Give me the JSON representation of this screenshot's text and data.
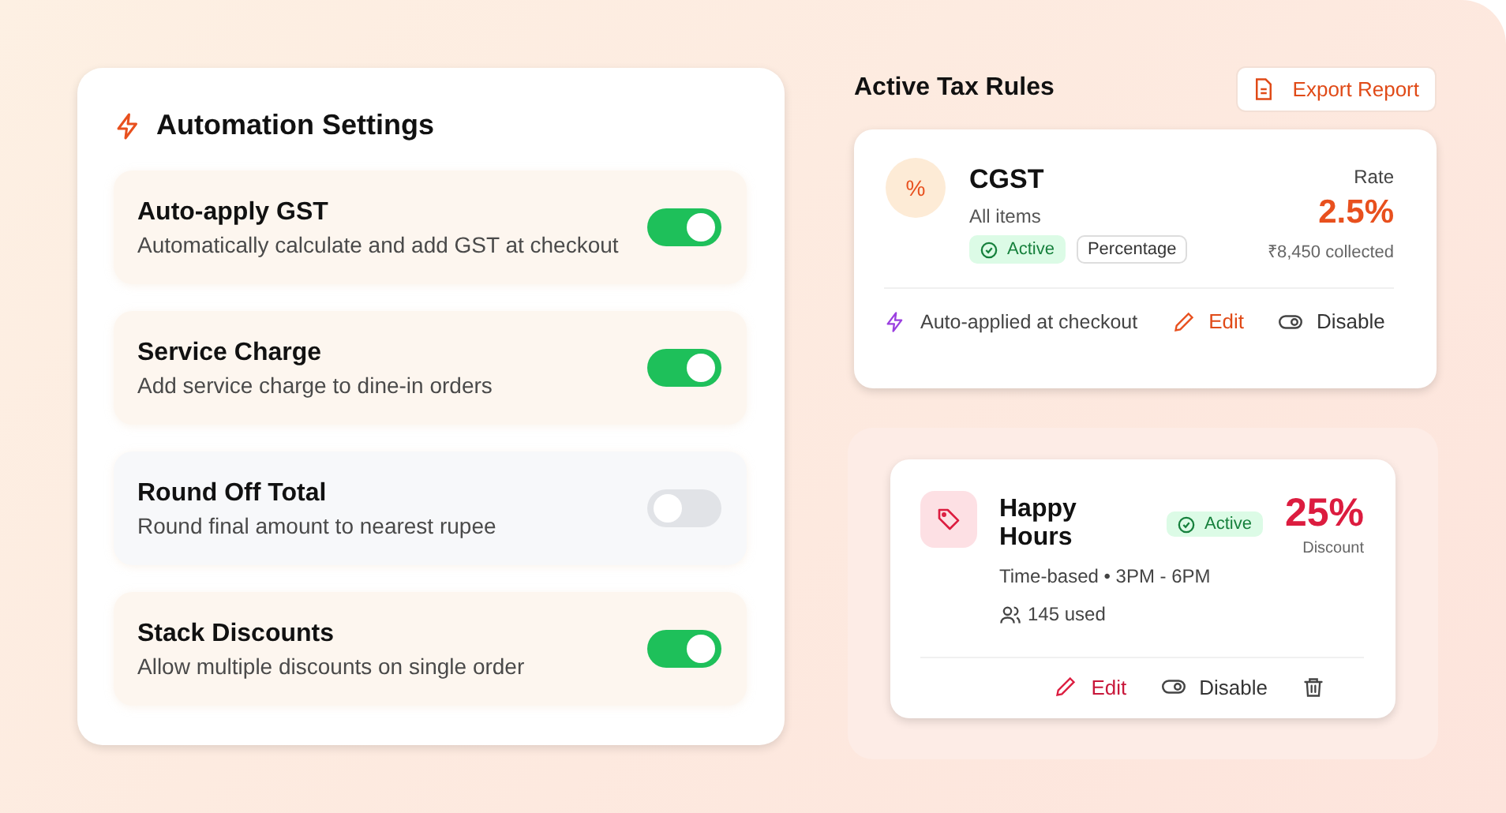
{
  "automation": {
    "title": "Automation Settings",
    "settings": [
      {
        "label": "Auto-apply GST",
        "description": "Automatically calculate and add GST at checkout",
        "on": true
      },
      {
        "label": "Service Charge",
        "description": "Add service charge to dine-in orders",
        "on": true
      },
      {
        "label": "Round Off Total",
        "description": "Round final amount to nearest rupee",
        "on": false
      },
      {
        "label": "Stack Discounts",
        "description": "Allow multiple discounts on single order",
        "on": true
      }
    ]
  },
  "tax_rules": {
    "title": "Active Tax Rules",
    "export_button": "Export Report",
    "rule": {
      "icon_text": "%",
      "name": "CGST",
      "scope": "All items",
      "status": "Active",
      "type": "Percentage",
      "rate_label": "Rate",
      "rate": "2.5%",
      "collected": "₹8,450 collected",
      "note": "Auto-applied at checkout",
      "actions": [
        {
          "kind": "edit",
          "label": "Edit"
        },
        {
          "kind": "disable",
          "label": "Disable"
        }
      ]
    }
  },
  "discount": {
    "name": "Happy Hours",
    "status": "Active",
    "schedule": "Time-based • 3PM - 6PM",
    "usage": "145 used",
    "value": "25%",
    "value_label": "Discount",
    "actions": [
      {
        "kind": "edit",
        "label": "Edit"
      },
      {
        "kind": "disable",
        "label": "Disable"
      },
      {
        "kind": "delete"
      }
    ]
  }
}
